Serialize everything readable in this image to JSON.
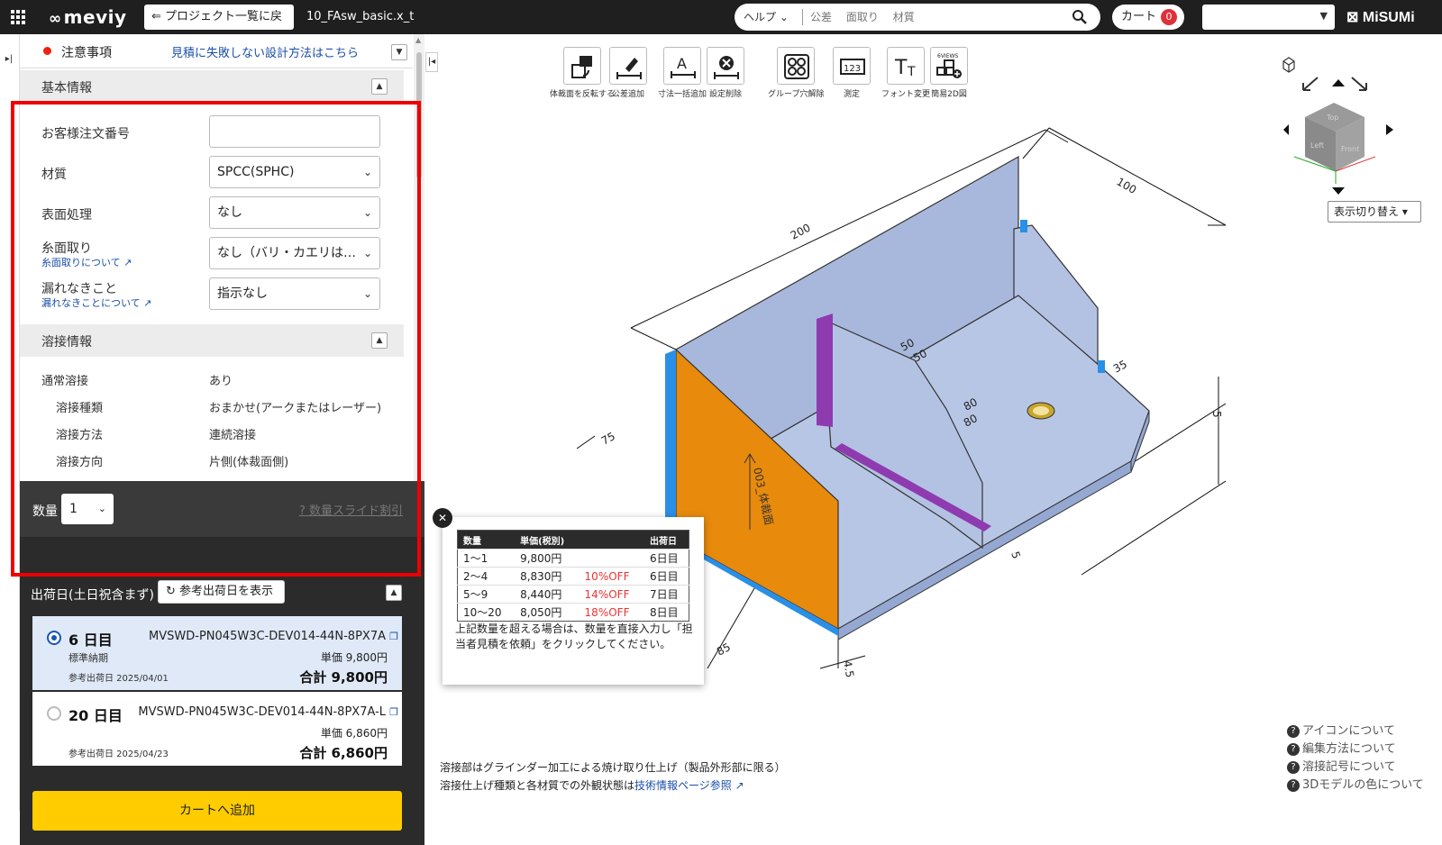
{
  "topbar": {
    "logo": "meviy",
    "back_label": "プロジェクト一覧に戻る",
    "file_name": "10_FAsw_basic.x_t",
    "help_label": "ヘルプ",
    "suggestions": [
      "公差",
      "面取り",
      "材質"
    ],
    "cart_label": "カート",
    "cart_count": "0",
    "select_value": "",
    "brand": "MiSUMi"
  },
  "notice": {
    "label": "注意事項",
    "link": "見積に失敗しない設計方法はこちら"
  },
  "basic": {
    "title": "基本情報",
    "order_no_label": "お客様注文番号",
    "order_no_value": "",
    "material_label": "材質",
    "material_value": "SPCC(SPHC)",
    "surface_label": "表面処理",
    "surface_value": "なし",
    "chamfer_label": "糸面取り",
    "chamfer_link": "糸面取りについて",
    "chamfer_value": "なし（バリ・カエリは…",
    "leak_label": "漏れなきこと",
    "leak_link": "漏れなきことについて",
    "leak_value": "指示なし"
  },
  "weld": {
    "title": "溶接情報",
    "rows": [
      {
        "k": "通常溶接",
        "v": "あり"
      },
      {
        "k": "溶接種類",
        "v": "おまかせ(アークまたはレーザー)"
      },
      {
        "k": "溶接方法",
        "v": "連続溶接"
      },
      {
        "k": "溶接方向",
        "v": "片側(体裁面側)"
      }
    ]
  },
  "quantity": {
    "label": "数量",
    "value": "1",
    "discount_link": "数量スライド割引"
  },
  "shipping": {
    "title": "出荷日(土日祝含まず)",
    "ref_button": "参考出荷日を表示",
    "options": [
      {
        "days": "6 日目",
        "std": "標準納期",
        "ref": "参考出荷日 2025/04/01",
        "code": "MVSWD-PN045W3C-DEV014-44N-8PX7A",
        "unit": "単価 9,800円",
        "total": "合計 9,800円",
        "selected": true
      },
      {
        "days": "20 日目",
        "std": "",
        "ref": "参考出荷日 2025/04/23",
        "code": "MVSWD-PN045W3C-DEV014-44N-8PX7A-L",
        "unit": "単価 6,860円",
        "total": "合計 6,860円",
        "selected": false
      }
    ],
    "cart_button": "カートへ追加"
  },
  "toolbar": [
    {
      "label": "体裁面を反転する",
      "icon": "flip-face-icon"
    },
    {
      "label": "公差追加",
      "icon": "tolerance-add-icon"
    },
    {
      "label": "寸法一括追加",
      "icon": "dimension-batch-icon"
    },
    {
      "label": "設定削除",
      "icon": "delete-setting-icon"
    },
    {
      "label": "グループ穴解除",
      "icon": "ungroup-holes-icon"
    },
    {
      "label": "測定",
      "icon": "measure-icon"
    },
    {
      "label": "フォント変更",
      "icon": "font-change-icon"
    },
    {
      "label": "簡易2D図",
      "icon": "simple-2d-icon",
      "badge": "6VIEWS"
    }
  ],
  "view": {
    "switch_label": "表示切り替え",
    "cube_faces": [
      "Top",
      "Left",
      "Front"
    ]
  },
  "model": {
    "dims": [
      "200",
      "100",
      "50",
      "50",
      "80",
      "80",
      "35",
      "75",
      "85",
      "5",
      "4.5",
      "5"
    ],
    "face_label": "003_体裁面"
  },
  "popup": {
    "headers": [
      "数量",
      "単価(税別)",
      "",
      "出荷日"
    ],
    "rows": [
      [
        "1〜1",
        "9,800円",
        "",
        "6日目"
      ],
      [
        "2〜4",
        "8,830円",
        "10%OFF",
        "6日目"
      ],
      [
        "5〜9",
        "8,440円",
        "14%OFF",
        "7日目"
      ],
      [
        "10〜20",
        "8,050円",
        "18%OFF",
        "8日目"
      ]
    ],
    "note": "上記数量を超える場合は、数量を直接入力し「担当者見積を依頼」をクリックしてください。"
  },
  "footer": {
    "line1": "溶接部はグラインダー加工による焼け取り仕上げ（製品外形部に限る）",
    "line2_prefix": "溶接仕上げ種類と各材質での外観状態は",
    "line2_link": "技術情報ページ参照"
  },
  "help": [
    "アイコンについて",
    "編集方法について",
    "溶接記号について",
    "3Dモデルの色について"
  ],
  "colors": {
    "accent": "#1a56b3",
    "cart": "#ffcc00",
    "highlight": "#ee0000",
    "weld": "#8e3bb0",
    "face": "#e88a0c",
    "edge": "#2a8fe6",
    "body": "#a8b8dc"
  }
}
